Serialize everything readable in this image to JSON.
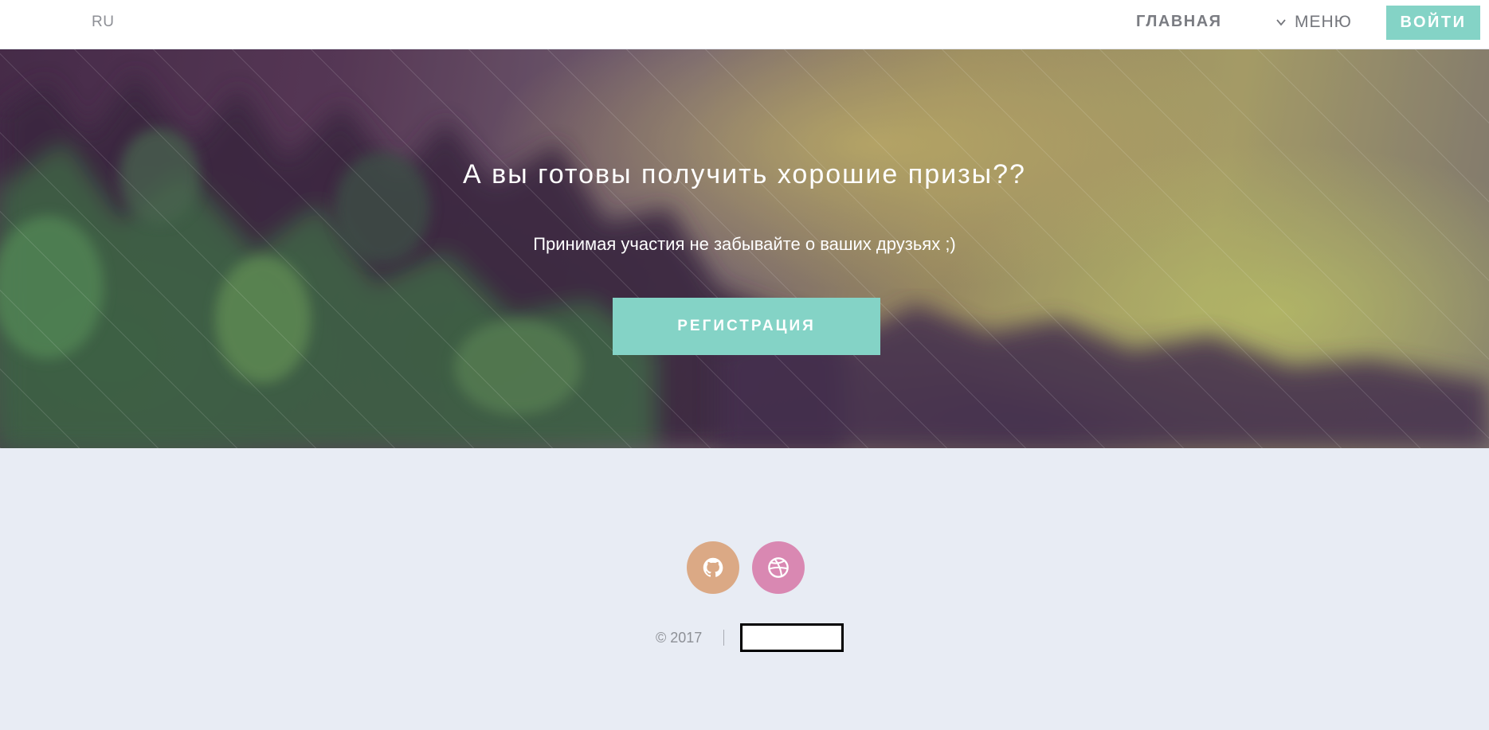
{
  "header": {
    "brand": "RU",
    "nav_home": "ГЛАВНАЯ",
    "nav_menu": "МЕНЮ",
    "nav_menu_icon": "chevron-down-icon",
    "login_label": "ВОЙТИ"
  },
  "hero": {
    "title": "А вы готовы получить хорошие призы??",
    "subtitle": "Принимая участия не забывайте о ваших друзьях ;)",
    "register_label": "РЕГИСТРАЦИЯ"
  },
  "footer": {
    "social": [
      {
        "icon": "github-icon",
        "color": "#dba985"
      },
      {
        "icon": "dribbble-icon",
        "color": "#d988b2"
      }
    ],
    "copyright": "© 2017"
  },
  "colors": {
    "accent": "#84d3c6",
    "header_bg": "#ffffff",
    "footer_bg": "#e8ecf4",
    "nav_text": "#7a7c82"
  }
}
